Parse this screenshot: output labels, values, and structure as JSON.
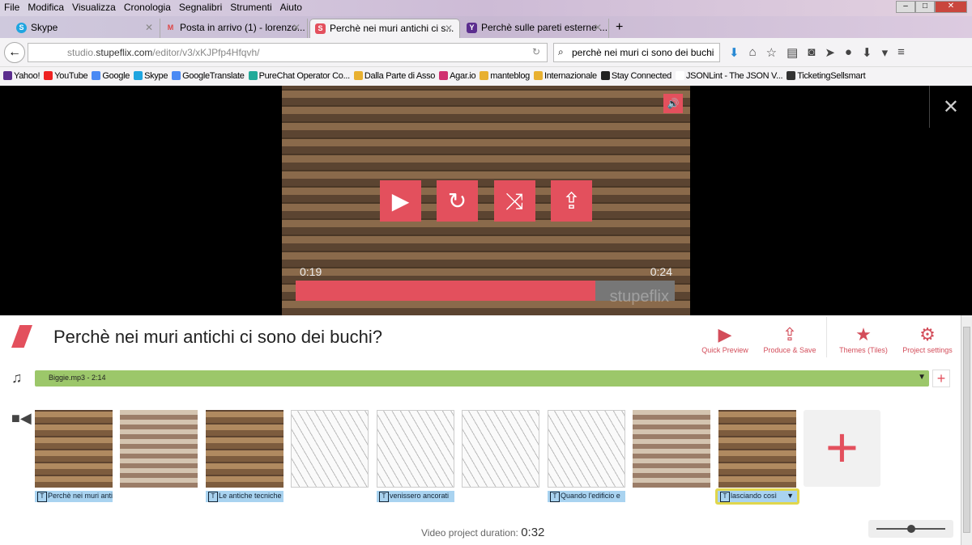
{
  "menu": [
    "File",
    "Modifica",
    "Visualizza",
    "Cronologia",
    "Segnalibri",
    "Strumenti",
    "Aiuto"
  ],
  "tabs": [
    {
      "label": "Skype",
      "icon": "S",
      "color": "#1fa5e0"
    },
    {
      "label": "Posta in arrivo (1) - lorenzo...",
      "icon": "M",
      "color": "#d44"
    },
    {
      "label": "Perchè nei muri antichi ci s...",
      "icon": "S",
      "color": "#e3505d"
    },
    {
      "label": "Perchè sulle pareti esterne ...",
      "icon": "Y",
      "color": "#5b2d8e"
    }
  ],
  "url": {
    "prefix": "studio.",
    "domain": "stupeflix.com",
    "path": "/editor/v3/xKJPfp4Hfqvh/"
  },
  "search": "perchè nei muri ci sono dei buchi",
  "bookmarks": [
    {
      "label": "Yahoo!",
      "color": "#5b2d8e"
    },
    {
      "label": "YouTube",
      "color": "#e22"
    },
    {
      "label": "Google",
      "color": "#4a8af4"
    },
    {
      "label": "Skype",
      "color": "#1fa5e0"
    },
    {
      "label": "GoogleTranslate",
      "color": "#4a8af4"
    },
    {
      "label": "PureChat Operator Co...",
      "color": "#2a9"
    },
    {
      "label": "Dalla Parte di Asso",
      "color": "#e8b030"
    },
    {
      "label": "Agar.io",
      "color": "#d03070"
    },
    {
      "label": "manteblog",
      "color": "#e8b030"
    },
    {
      "label": "Internazionale",
      "color": "#e8b030"
    },
    {
      "label": "Stay Connected",
      "color": "#222"
    },
    {
      "label": "JSONLint - The JSON V...",
      "color": "#fff"
    },
    {
      "label": "TicketingSellsmart",
      "color": "#333"
    }
  ],
  "player": {
    "current": "0:19",
    "total": "0:24",
    "progress": 0.79,
    "watermark": "stupeflix"
  },
  "project": {
    "title": "Perchè nei muri antichi ci sono dei buchi?",
    "actions": [
      "Quick Preview",
      "Produce & Save",
      "Themes (Tiles)",
      "Project settings"
    ],
    "music": "Biggie.mp3 - 2:14",
    "duration_label": "Video project duration:",
    "duration": "0:32"
  },
  "captions": [
    "Perchè nei muri antichi",
    "Le antiche tecniche",
    "venissero ancorati",
    "Quando l'edificio e",
    "lasciando così"
  ],
  "accent": "#e3505d"
}
